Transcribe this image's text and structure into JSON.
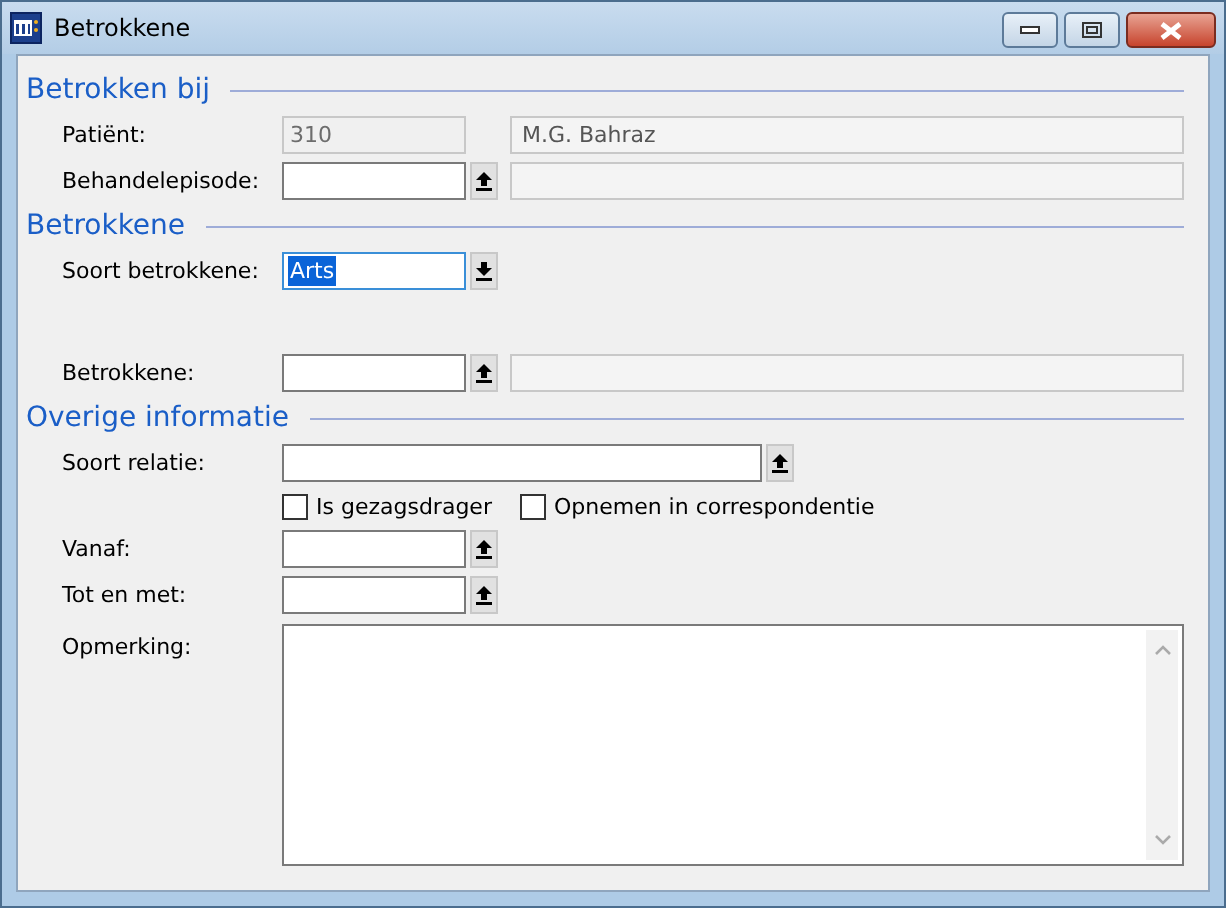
{
  "window": {
    "title": "Betrokkene"
  },
  "sections": [
    {
      "heading": "Betrokken bij",
      "rows": [
        {
          "kind": "field",
          "label": "Patiënt:",
          "value": "310",
          "disabled": true,
          "detail": {
            "value": "M.G. Bahraz",
            "disabled": true
          }
        },
        {
          "kind": "field",
          "label": "Behandelepisode:",
          "disabled": false,
          "lookup": true,
          "detail": {
            "disabled": true
          }
        }
      ]
    },
    {
      "heading": "Betrokkene",
      "rows": [
        {
          "kind": "field",
          "label": "Soort betrokkene:",
          "value": "Arts",
          "disabled": false,
          "focused": true,
          "text_selected": true,
          "dropdown": true
        },
        {
          "kind": "field",
          "label": "Betrokkene:",
          "disabled": false,
          "lookup": true,
          "detail": {
            "disabled": true
          },
          "spaced": true
        }
      ]
    },
    {
      "heading": "Overige informatie",
      "rows": [
        {
          "kind": "field",
          "label": "Soort relatie:",
          "disabled": false,
          "wide": true,
          "lookup": true
        },
        {
          "kind": "checkboxes",
          "items": [
            {
              "label": "Is gezagsdrager",
              "checked": false
            },
            {
              "label": "Opnemen in correspondentie",
              "checked": false
            }
          ]
        },
        {
          "kind": "field",
          "label": "Vanaf:",
          "disabled": false,
          "lookup": true
        },
        {
          "kind": "field",
          "label": "Tot en met:",
          "disabled": false,
          "lookup": true
        },
        {
          "kind": "memo",
          "label": "Opmerking:"
        }
      ]
    }
  ]
}
